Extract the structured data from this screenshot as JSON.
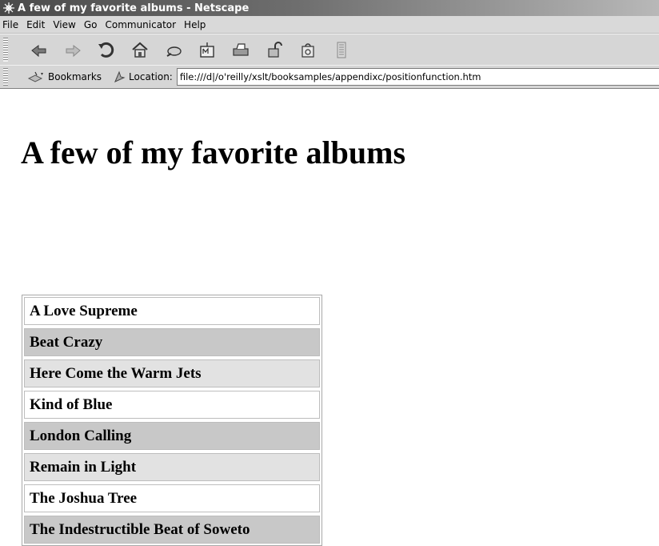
{
  "window": {
    "title": "A few of my favorite albums - Netscape"
  },
  "menu": {
    "items": [
      "File",
      "Edit",
      "View",
      "Go",
      "Communicator",
      "Help"
    ]
  },
  "toolbar": {
    "buttons": [
      "back-icon",
      "forward-icon",
      "reload-icon",
      "home-icon",
      "search-icon",
      "my-netscape-icon",
      "print-icon",
      "security-icon",
      "shop-icon",
      "stop-icon"
    ]
  },
  "location_bar": {
    "bookmarks_label": "Bookmarks",
    "location_label": "Location:",
    "url": "file:///d|/o'reilly/xslt/booksamples/appendixc/positionfunction.htm"
  },
  "page": {
    "heading": "A few of my favorite albums",
    "albums": [
      {
        "title": "A Love Supreme",
        "shade": "white"
      },
      {
        "title": "Beat Crazy",
        "shade": "dark-gray"
      },
      {
        "title": "Here Come the Warm Jets",
        "shade": "light-gray"
      },
      {
        "title": "Kind of Blue",
        "shade": "white"
      },
      {
        "title": "London Calling",
        "shade": "dark-gray"
      },
      {
        "title": "Remain in Light",
        "shade": "light-gray"
      },
      {
        "title": "The Joshua Tree",
        "shade": "white"
      },
      {
        "title": "The Indestructible Beat of Soweto",
        "shade": "dark-gray"
      }
    ]
  },
  "colors": {
    "white": "#ffffff",
    "dark-gray": "#c8c8c8",
    "light-gray": "#e2e2e2"
  }
}
